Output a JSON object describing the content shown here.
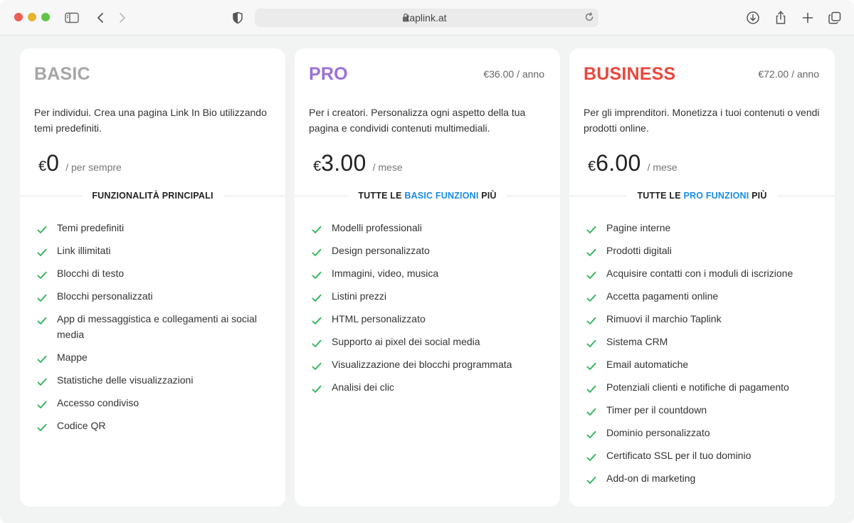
{
  "browser": {
    "url": "taplink.at"
  },
  "colors": {
    "basic": "#a6a6a6",
    "pro": "#9a6fd8",
    "business": "#e9483d",
    "highlight": "#1a8be8",
    "check": "#31b55a"
  },
  "plans": [
    {
      "name": "BASIC",
      "annual": "",
      "description": "Per individui. Crea una pagina Link In Bio utilizzando temi predefiniti.",
      "currency": "€",
      "amount": "0",
      "period": "/ per sempre",
      "divider": {
        "prefix": "FUNZIONALITÀ PRINCIPALI",
        "highlight": "",
        "suffix": ""
      },
      "features": [
        "Temi predefiniti",
        "Link illimitati",
        "Blocchi di testo",
        "Blocchi personalizzati",
        "App di messaggistica e collegamenti ai social media",
        "Mappe",
        "Statistiche delle visualizzazioni",
        "Accesso condiviso",
        "Codice QR"
      ]
    },
    {
      "name": "PRO",
      "annual": "€36.00 / anno",
      "description": "Per i creatori. Personalizza ogni aspetto della tua pagina e condividi contenuti multimediali.",
      "currency": "€",
      "amount": "3.00",
      "period": "/ mese",
      "divider": {
        "prefix": "TUTTE LE ",
        "highlight": "BASIC FUNZIONI",
        "suffix": " PIÙ"
      },
      "features": [
        "Modelli professionali",
        "Design personalizzato",
        "Immagini, video, musica",
        "Listini prezzi",
        "HTML personalizzato",
        "Supporto ai pixel dei social media",
        "Visualizzazione dei blocchi programmata",
        "Analisi dei clic"
      ]
    },
    {
      "name": "BUSINESS",
      "annual": "€72.00 / anno",
      "description": "Per gli imprenditori. Monetizza i tuoi contenuti o vendi prodotti online.",
      "currency": "€",
      "amount": "6.00",
      "period": "/ mese",
      "divider": {
        "prefix": "TUTTE LE ",
        "highlight": "PRO FUNZIONI",
        "suffix": " PIÙ"
      },
      "features": [
        "Pagine interne",
        "Prodotti digitali",
        "Acquisire contatti con i moduli di iscrizione",
        "Accetta pagamenti online",
        "Rimuovi il marchio Taplink",
        "Sistema CRM",
        "Email automatiche",
        "Potenziali clienti e notifiche di pagamento",
        "Timer per il countdown",
        "Dominio personalizzato",
        "Certificato SSL per il tuo dominio",
        "Add-on di marketing"
      ]
    }
  ]
}
